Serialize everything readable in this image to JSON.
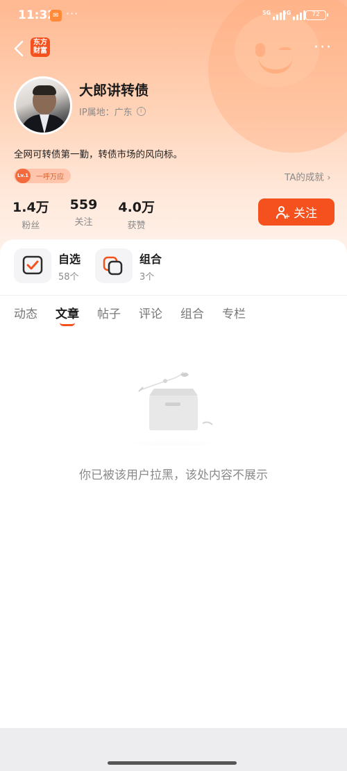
{
  "status_bar": {
    "time": "11:32",
    "dots": "···",
    "net1": "5G",
    "net2": "5G",
    "battery": "72"
  },
  "nav": {
    "logo_text": "东方财富",
    "more": "···"
  },
  "profile": {
    "name": "大郎讲转债",
    "ip_location": "IP属地：广东",
    "bio": "全网可转债第一勤，转债市场的风向标。",
    "level_badge": "Lv.1",
    "level_text": "一呼万应",
    "achievements_link": "TA的成就 ›"
  },
  "stats": [
    {
      "value": "1.4万",
      "label": "粉丝"
    },
    {
      "value": "559",
      "label": "关注"
    },
    {
      "value": "4.0万",
      "label": "获赞"
    }
  ],
  "follow_button": "关注",
  "quick_entries": [
    {
      "title": "自选",
      "sub": "58个"
    },
    {
      "title": "组合",
      "sub": "3个"
    }
  ],
  "tabs": [
    "动态",
    "文章",
    "帖子",
    "评论",
    "组合",
    "专栏"
  ],
  "active_tab": "文章",
  "empty_message": "你已被该用户拉黑，该处内容不展示",
  "colors": {
    "accent": "#f4511e",
    "header_gradient_top": "#ffb891",
    "text_secondary": "#8a8a8a"
  }
}
